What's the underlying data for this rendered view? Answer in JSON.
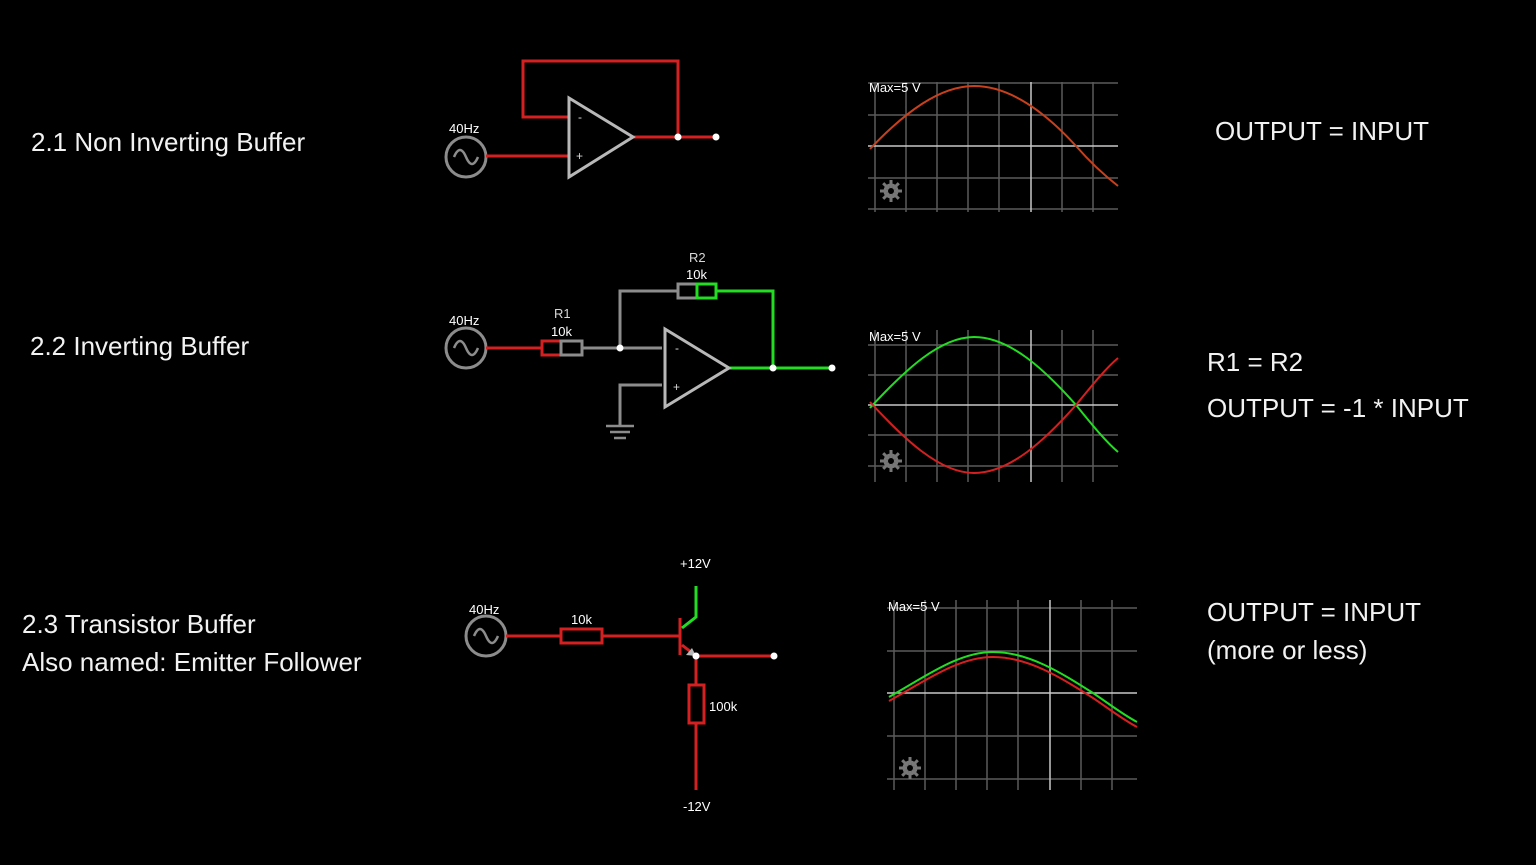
{
  "colors": {
    "red": "#d42020",
    "green": "#22dd22",
    "gray": "#8c8c8c",
    "grid": "#5a5a5a",
    "background": "#000000"
  },
  "sections": [
    {
      "title": "2.1 Non Inverting Buffer",
      "source_label": "40Hz",
      "scope_label": "Max=5 V",
      "notes": [
        "OUTPUT = INPUT"
      ],
      "scope_traces": [
        {
          "color": "red",
          "shape": "sine",
          "values_v": [
            0,
            3.5,
            5,
            3.5,
            0,
            -2.5
          ]
        }
      ]
    },
    {
      "title": "2.2 Inverting Buffer",
      "source_label": "40Hz",
      "r1_name": "R1",
      "r1_value": "10k",
      "r2_name": "R2",
      "r2_value": "10k",
      "scope_label": "Max=5 V",
      "notes": [
        "R1 = R2",
        "OUTPUT = -1 * INPUT"
      ],
      "scope_traces": [
        {
          "color": "green",
          "shape": "sine"
        },
        {
          "color": "red",
          "shape": "inverted sine"
        }
      ]
    },
    {
      "title": "2.3 Transistor Buffer",
      "subtitle": "Also named: Emitter Follower",
      "source_label": "40Hz",
      "base_resistor": "10k",
      "emitter_resistor": "100k",
      "supply_pos": "+12V",
      "supply_neg": "-12V",
      "scope_label": "Max=5 V",
      "notes": [
        "OUTPUT = INPUT",
        "(more or less)"
      ],
      "scope_traces": [
        {
          "color": "green",
          "shape": "sine"
        },
        {
          "color": "red",
          "shape": "sine (slightly lower)"
        }
      ]
    }
  ],
  "icons": [
    "sine-source-icon",
    "op-amp-icon",
    "resistor-icon",
    "ground-icon",
    "npn-transistor-icon",
    "settings-gear-icon"
  ]
}
